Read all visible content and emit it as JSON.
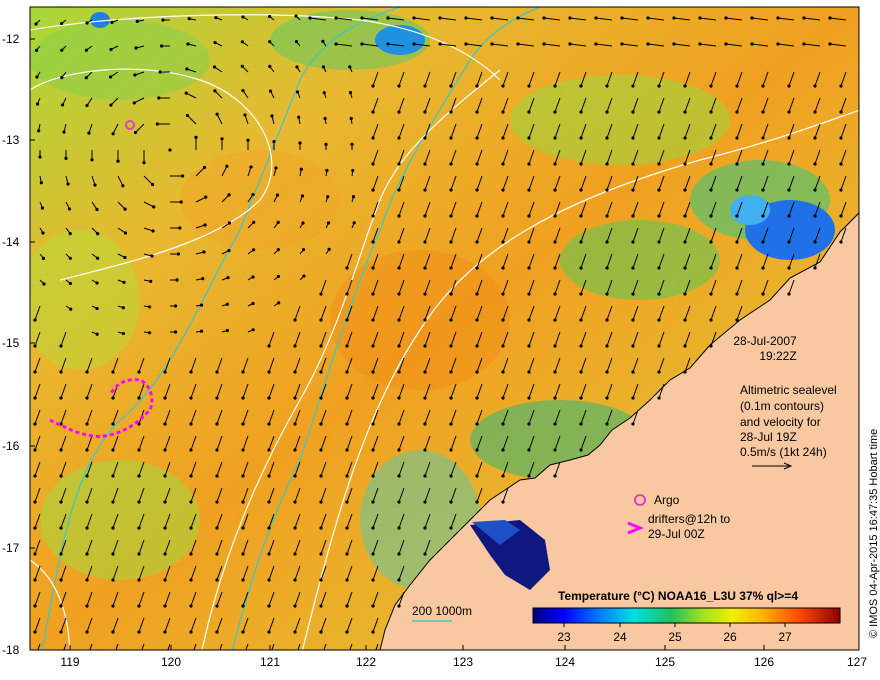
{
  "map": {
    "x_ticks": [
      "119",
      "120",
      "121",
      "122",
      "123",
      "124",
      "125",
      "126",
      "127"
    ],
    "y_ticks": [
      "-12",
      "-13",
      "-14",
      "-15",
      "-16",
      "-17",
      "-18"
    ]
  },
  "annotations": {
    "date": "28-Jul-2007",
    "time": "19:22Z",
    "altimetry_lines": [
      "Altimetric sealevel",
      "(0.1m contours)",
      "and velocity for",
      "28-Jul 19Z",
      "0.5m/s (1kt 24h)"
    ],
    "argo_label": "Argo",
    "drifters_lines": [
      "drifters@12h to",
      "29-Jul 00Z"
    ],
    "bathy_label": "200  1000m"
  },
  "colorbar": {
    "title": "Temperature (°C) NOAA16_L3U 37% ql>=4",
    "tick_labels": [
      "23",
      "24",
      "25",
      "26",
      "27"
    ]
  },
  "credit": "© IMOS 04-Apr-2015 16:47:35 Hobart time",
  "colors": {
    "land": "#f8c8a0",
    "argo": "#e040c0",
    "drifter": "#ff00ff",
    "bathy_contour": "#40c8c0",
    "sealevel_contour": "#ffffff"
  }
}
